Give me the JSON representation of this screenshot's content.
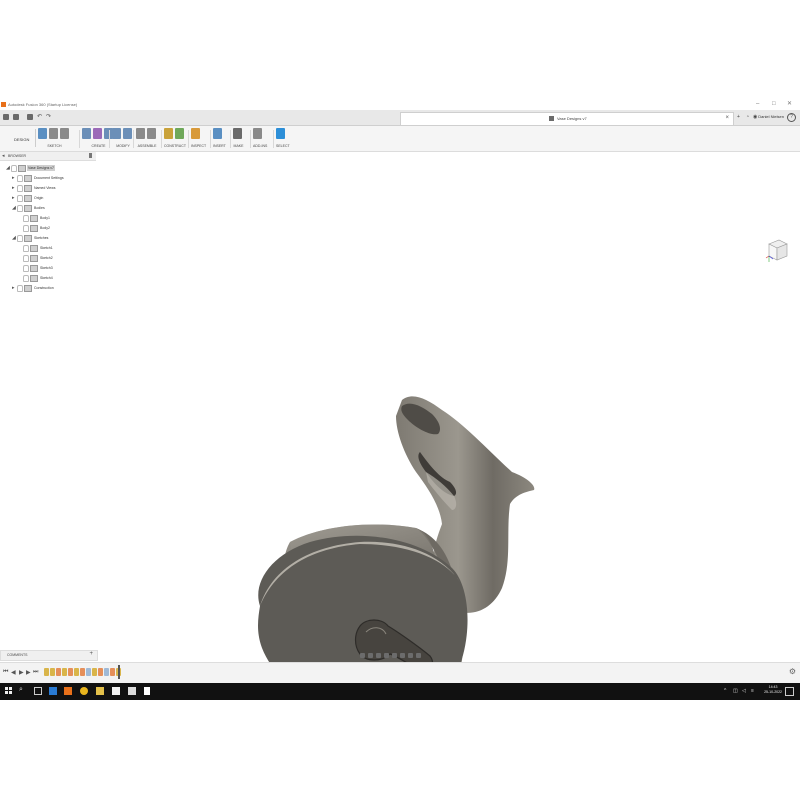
{
  "window": {
    "title": "Autodesk Fusion 360 (Startup License)",
    "controls": [
      "–",
      "□",
      "✕"
    ]
  },
  "tabbar": {
    "document_title": "Vase Designs v7",
    "user": "Daniel Nielsen"
  },
  "ribbon": {
    "workspace": "DESIGN",
    "groups": [
      {
        "label": "SKETCH",
        "colors": [
          "#5a8fc2",
          "#8a8a8a",
          "#8a8a8a"
        ]
      },
      {
        "label": "CREATE",
        "colors": [
          "#6b8fb8",
          "#9b6ab8",
          "#6b8fb8"
        ]
      },
      {
        "label": "MODIFY",
        "colors": [
          "#6b8fb8",
          "#6b8fb8"
        ]
      },
      {
        "label": "ASSEMBLE",
        "colors": [
          "#8a8a8a",
          "#8a8a8a"
        ]
      },
      {
        "label": "CONSTRUCT",
        "colors": [
          "#c9a23a",
          "#6fa85a"
        ]
      },
      {
        "label": "INSPECT",
        "colors": [
          "#d89a3a"
        ]
      },
      {
        "label": "INSERT",
        "colors": [
          "#5a8fc2"
        ]
      },
      {
        "label": "MAKE",
        "colors": [
          "#6a6a6a"
        ]
      },
      {
        "label": "ADD-INS",
        "colors": [
          "#8a8a8a"
        ]
      },
      {
        "label": "SELECT",
        "colors": [
          "#2d8fd8"
        ]
      }
    ]
  },
  "browser": {
    "title": "BROWSER",
    "items": [
      {
        "label": "Vase Designs v7",
        "indent": 0,
        "arrow": "◢"
      },
      {
        "label": "Document Settings",
        "indent": 1,
        "arrow": "▸"
      },
      {
        "label": "Named Views",
        "indent": 1,
        "arrow": "▸"
      },
      {
        "label": "Origin",
        "indent": 1,
        "arrow": "▸"
      },
      {
        "label": "Bodies",
        "indent": 1,
        "arrow": "◢"
      },
      {
        "label": "Body1",
        "indent": 2,
        "arrow": ""
      },
      {
        "label": "Body2",
        "indent": 2,
        "arrow": ""
      },
      {
        "label": "Sketches",
        "indent": 1,
        "arrow": "◢"
      },
      {
        "label": "Sketch1",
        "indent": 2,
        "arrow": ""
      },
      {
        "label": "Sketch2",
        "indent": 2,
        "arrow": ""
      },
      {
        "label": "Sketch3",
        "indent": 2,
        "arrow": ""
      },
      {
        "label": "Sketch4",
        "indent": 2,
        "arrow": ""
      },
      {
        "label": "Construction",
        "indent": 1,
        "arrow": "▸"
      }
    ]
  },
  "comments": {
    "label": "COMMENTS"
  },
  "timeline": {
    "feature_colors": [
      "#d9b54a",
      "#d9b54a",
      "#e58f5a",
      "#d9b54a",
      "#e58f5a",
      "#d9b54a",
      "#e58f5a",
      "#9fb9d6",
      "#d9b54a",
      "#e58f5a",
      "#9fb9d6",
      "#e58f5a",
      "#d9b54a"
    ]
  },
  "taskbar": {
    "time": "14:43",
    "date": "25-10-2022"
  },
  "colors": {
    "model_body": "#8a867d",
    "model_base_face": "#5d5b56",
    "accent_select": "#2d8fd8"
  }
}
